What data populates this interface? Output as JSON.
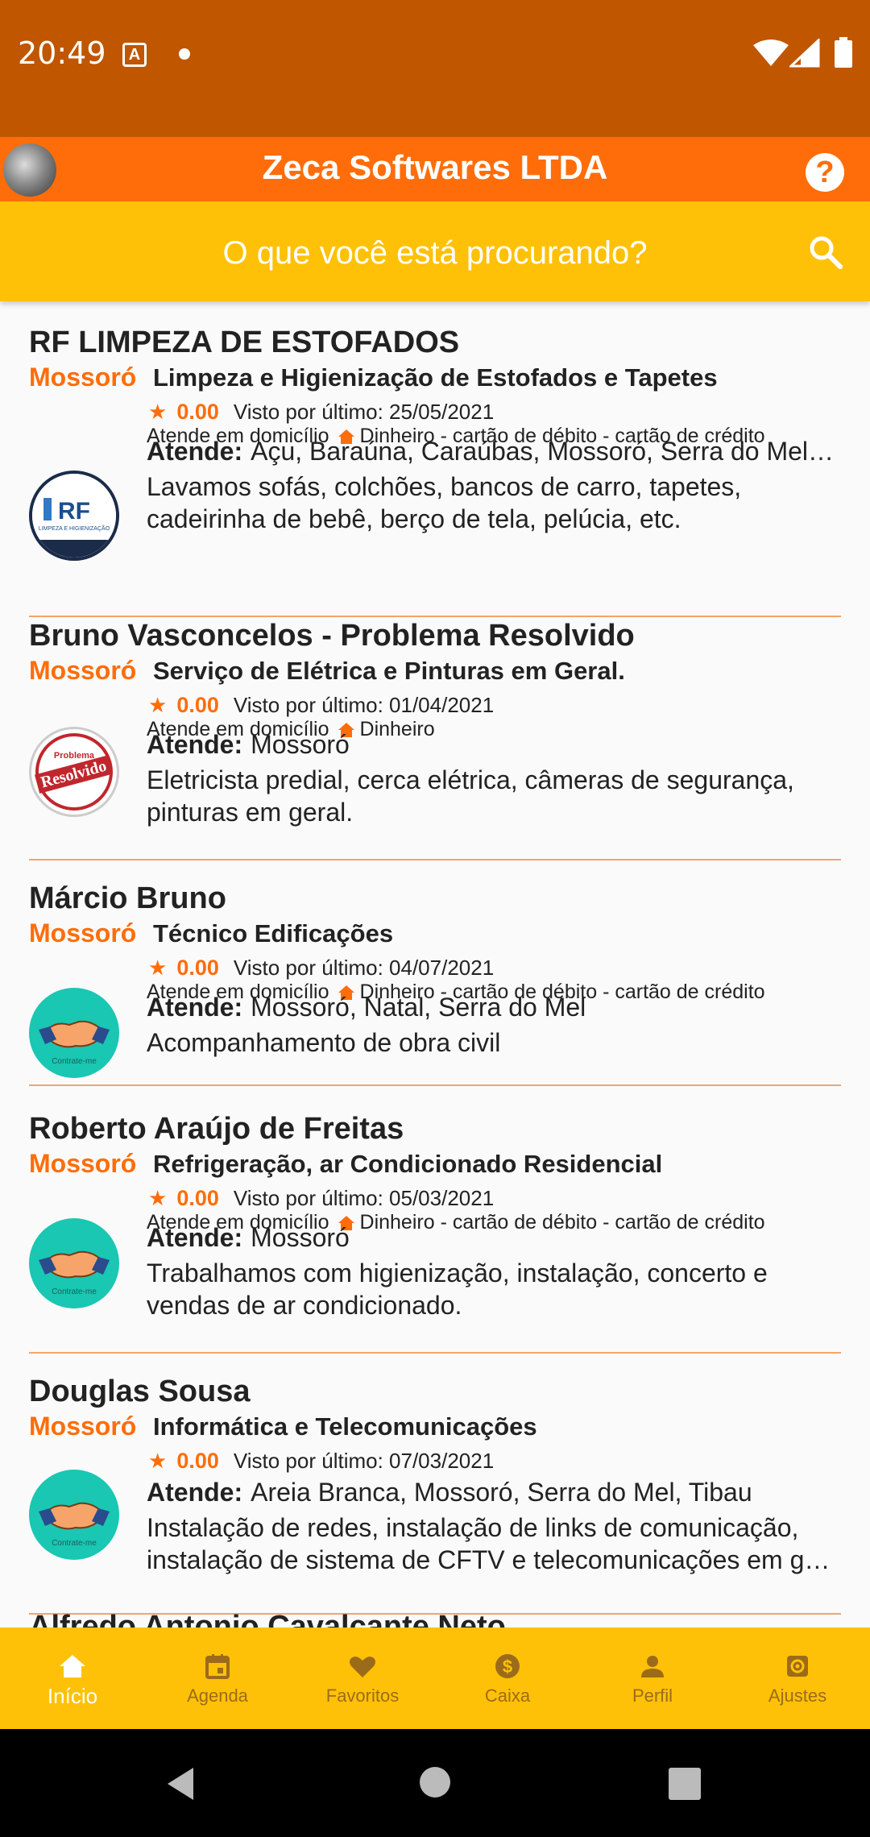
{
  "status_bar": {
    "time": "20:49"
  },
  "app_bar": {
    "title": "Zeca Softwares LTDA"
  },
  "search": {
    "placeholder": "O que você está procurando?"
  },
  "listings": [
    {
      "name": "RF LIMPEZA DE ESTOFADOS",
      "city": "Mossoró",
      "category": "Limpeza e Higienização de Estofados e Tapetes",
      "rating": "0.00",
      "last_seen": "Visto por último: 25/05/2021",
      "home_service": "Atende em domicílio",
      "payment": "Dinheiro - cartão de débito - cartão de crédito",
      "atende_label": "Atende:",
      "atende_value": "Açu, Baraúna, Caraúbas, Mossoró, Serra do Mel, Tibau, Upanema",
      "description": "Lavamos sofás, colchões, bancos de carro, tapetes, cadeirinha de bebê, berço de tela, pelúcia, etc."
    },
    {
      "name": "Bruno Vasconcelos - Problema Resolvido",
      "city": "Mossoró",
      "category": "Serviço de Elétrica e Pinturas em Geral.",
      "rating": "0.00",
      "last_seen": "Visto por último: 01/04/2021",
      "home_service": "Atende em domicílio",
      "payment": "Dinheiro",
      "atende_label": "Atende:",
      "atende_value": "Mossoró",
      "description": "Eletricista predial, cerca elétrica, câmeras de segurança, pinturas em geral."
    },
    {
      "name": "Márcio Bruno",
      "city": "Mossoró",
      "category": "Técnico Edificações",
      "rating": "0.00",
      "last_seen": "Visto por último: 04/07/2021",
      "home_service": "Atende em domicílio",
      "payment": "Dinheiro - cartão de débito - cartão de crédito",
      "atende_label": "Atende:",
      "atende_value": "Mossoró, Natal, Serra do Mel",
      "description": "Acompanhamento de obra civil"
    },
    {
      "name": "Roberto Araújo de Freitas",
      "city": "Mossoró",
      "category": "Refrigeração, ar Condicionado Residencial",
      "rating": "0.00",
      "last_seen": "Visto por último: 05/03/2021",
      "home_service": "Atende em domicílio",
      "payment": "Dinheiro - cartão de débito - cartão de crédito",
      "atende_label": "Atende:",
      "atende_value": "Mossoró",
      "description": "Trabalhamos com higienização, instalação, concerto e vendas de ar condicionado."
    },
    {
      "name": "Douglas Sousa",
      "city": "Mossoró",
      "category": "Informática e Telecomunicações",
      "rating": "0.00",
      "last_seen": "Visto por último: 07/03/2021",
      "atende_label": "Atende:",
      "atende_value": "Areia Branca, Mossoró, Serra do Mel, Tibau",
      "description_line1": "Instalação de redes, instalação de links de comunicação,",
      "description_line2": "instalação de sistema de CFTV e telecomunicações em geral."
    }
  ],
  "partial_listing_name": "Alfredo Antonio Cavalcante Neto",
  "logos": {
    "rf_text": "RF",
    "rf_caption": "LIMPEZA E HIGIENIZAÇÃO",
    "resolvido_top": "Problema",
    "resolvido_main": "Resolvido",
    "handshake_caption": "Contrate-me"
  },
  "bottom_nav": [
    {
      "label": "Início",
      "icon": "home-icon",
      "active": true
    },
    {
      "label": "Agenda",
      "icon": "calendar-icon",
      "active": false
    },
    {
      "label": "Favoritos",
      "icon": "heart-icon",
      "active": false
    },
    {
      "label": "Caixa",
      "icon": "dollar-icon",
      "active": false
    },
    {
      "label": "Perfil",
      "icon": "person-icon",
      "active": false
    },
    {
      "label": "Ajustes",
      "icon": "settings-icon",
      "active": false
    }
  ],
  "colors": {
    "status_bar": "#c05600",
    "app_bar": "#ff6d0a",
    "accent_yellow": "#ffc107",
    "accent_orange": "#ff6d0a"
  }
}
